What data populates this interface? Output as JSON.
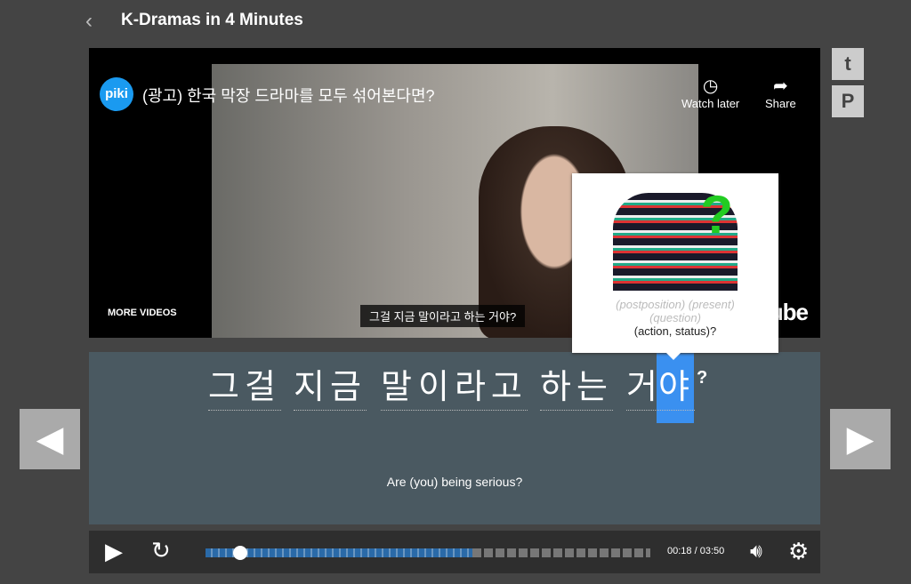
{
  "header": {
    "back_icon": "chevron-left-icon",
    "title": "K-Dramas in 4 Minutes"
  },
  "video": {
    "channel_logo": "piki",
    "title": "(광고) 한국 막장 드라마를 모두 섞어본다면?",
    "watch_later": "Watch later",
    "share": "Share",
    "more_videos": "MORE VIDEOS",
    "subtitle": "그걸 지금 말이라고 하는 거야?",
    "youtube": "YouTube"
  },
  "social": [
    "twitter-icon",
    "pinterest-icon"
  ],
  "subtitle": {
    "words": [
      "그걸",
      "지금",
      "말",
      "이라고",
      "하는",
      "거",
      "야"
    ],
    "punct": "?",
    "translation": "Are (you) being serious?",
    "highlight_color": "#3a90f0"
  },
  "tooltip": {
    "tags": "(postposition) (present)",
    "tag2": "(question)",
    "meaning": "(action, status)?"
  },
  "player": {
    "current": "00:18",
    "sep": "/",
    "duration": "03:50",
    "progress_percent": 7.8
  }
}
